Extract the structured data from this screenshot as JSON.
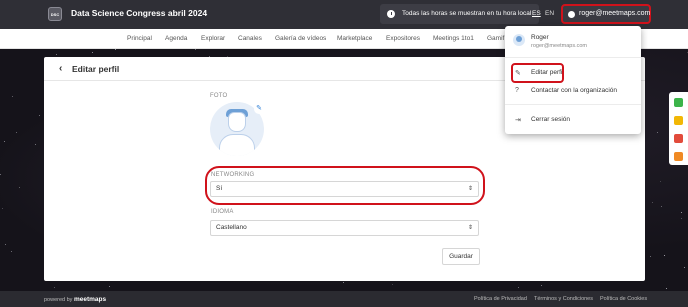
{
  "header": {
    "logo_text": "DSC",
    "event_title": "Data Science Congress abril 2024",
    "timezone_note": "Todas las horas se muestran en tu hora local",
    "lang_es": "ES",
    "lang_en": "EN",
    "user_email": "roger@meetmaps.com"
  },
  "nav": {
    "items": [
      "Principal",
      "Agenda",
      "Explorar",
      "Canales",
      "Galería de vídeos",
      "Marketplace",
      "Expositores",
      "Meetings 1to1",
      "Gamif"
    ]
  },
  "profile": {
    "title": "Editar perfil",
    "photo_label": "FOTO",
    "networking_label": "NETWORKING",
    "networking_value": "Sí",
    "language_label": "IDIOMA",
    "language_value": "Castellano",
    "save_label": "Guardar"
  },
  "user_menu": {
    "name": "Roger",
    "email": "roger@meetmaps.com",
    "edit_profile": "Editar perfil",
    "contact_org": "Contactar con la organización",
    "logout": "Cerrar sesión"
  },
  "footer": {
    "powered_by": "powered by",
    "brand": "meetmaps",
    "privacy": "Política de Privacidad",
    "terms": "Términos y Condiciones",
    "cookies": "Política de Cookies"
  },
  "colors": {
    "accent_red": "#d0121b",
    "header_bg": "#2f2f36",
    "side_green": "#3cb44a",
    "side_yellow": "#f2b705",
    "side_red": "#e24b3b",
    "side_orange": "#f08a24"
  }
}
